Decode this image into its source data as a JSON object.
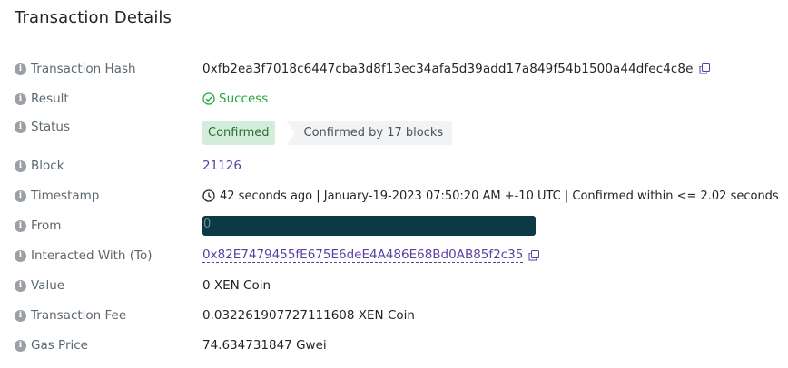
{
  "title": "Transaction Details",
  "rows": [
    {
      "label": "Transaction Hash",
      "value": "0xfb2ea3f7018c6447cba3d8f13ec34afa5d39add17a849f54b1500a44dfec4c8e"
    },
    {
      "label": "Result",
      "value": "Success"
    },
    {
      "label": "Status",
      "confirmed": "Confirmed",
      "blocks": "Confirmed by 17 blocks"
    },
    {
      "label": "Block",
      "value": "21126"
    },
    {
      "label": "Timestamp",
      "value": "42 seconds ago | January-19-2023 07:50:20 AM +-10 UTC | Confirmed within <= 2.02 seconds"
    },
    {
      "label": "From",
      "value": "0"
    },
    {
      "label": "Interacted With (To)",
      "value": "0x82E7479455fE675E6deE4A486E68Bd0AB85f2c35"
    },
    {
      "label": "Value",
      "value": "0 XEN Coin"
    },
    {
      "label": "Transaction Fee",
      "value": "0.032261907727111608 XEN Coin"
    },
    {
      "label": "Gas Price",
      "value": "74.634731847 Gwei"
    }
  ],
  "icons": {
    "info": "info-icon",
    "copy": "copy-icon",
    "success": "check-circle-icon",
    "clock": "clock-icon"
  },
  "colors": {
    "success": "#28a745",
    "link": "#5b3fa4",
    "redaction": "#0b3a44",
    "badge_confirmed_bg": "#d4edda",
    "badge_blocks_bg": "#f1f3f4"
  }
}
